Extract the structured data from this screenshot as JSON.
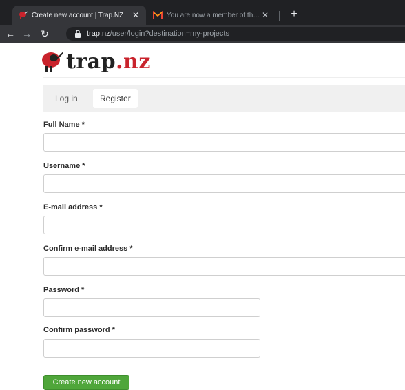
{
  "browser": {
    "tabs": [
      {
        "title": "Create new account | Trap.NZ",
        "active": true,
        "favicon": "trapnz-kiwi-icon"
      },
      {
        "title": "You are now a member of the Ha",
        "active": false,
        "favicon": "gmail-icon"
      }
    ],
    "url": {
      "host": "trap.nz",
      "path": "/user/login?destination=my-projects"
    }
  },
  "site": {
    "logo_name": "trap",
    "logo_tld": ".nz",
    "brand_color": "#c9232c"
  },
  "auth_tabs": {
    "login": "Log in",
    "register": "Register"
  },
  "form": {
    "full_name_label": "Full Name *",
    "username_label": "Username *",
    "email_label": "E-mail address *",
    "confirm_email_label": "Confirm e-mail address *",
    "password_label": "Password *",
    "confirm_password_label": "Confirm password *",
    "full_name_value": "",
    "username_value": "",
    "email_value": "",
    "confirm_email_value": "",
    "password_value": "",
    "confirm_password_value": "",
    "submit_label": "Create new account",
    "submit_color": "#4fa63a"
  }
}
